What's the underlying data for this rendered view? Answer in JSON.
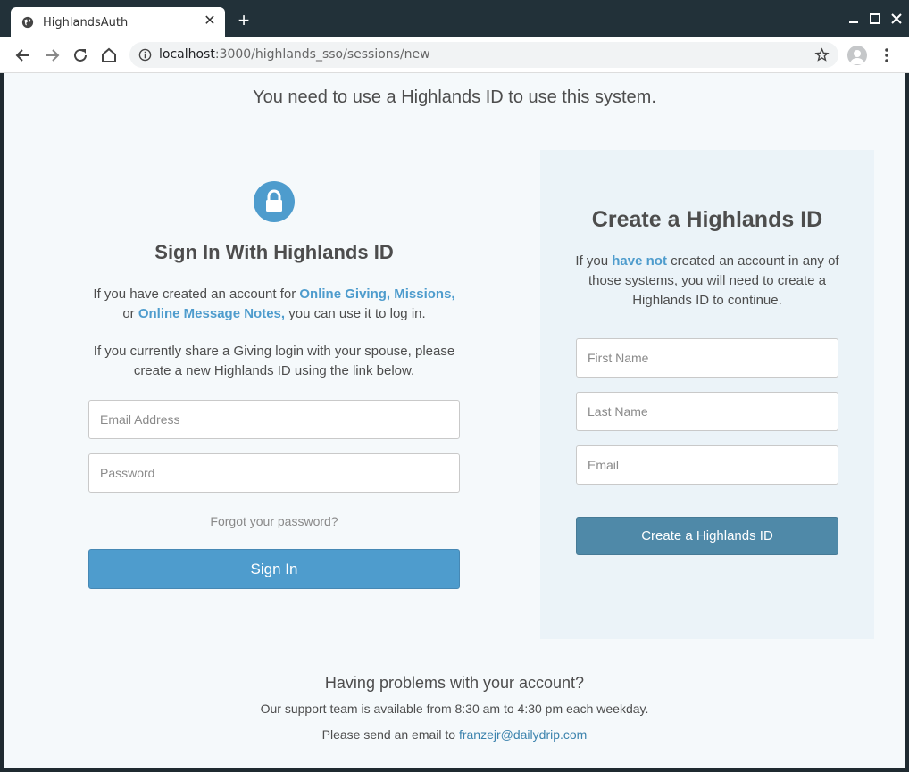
{
  "browser": {
    "tab_title": "HighlandsAuth",
    "url_host": "localhost",
    "url_rest": ":3000/highlands_sso/sessions/new"
  },
  "page": {
    "notice": "You need to use a Highlands ID to use this system."
  },
  "signin": {
    "title": "Sign In With Highlands ID",
    "p1_prefix": "If you have created an account for ",
    "p1_link1": "Online Giving, Missions,",
    "p1_mid": "or ",
    "p1_link2": "Online Message Notes,",
    "p1_suffix": " you can use it to log in.",
    "p2": "If you currently share a Giving login with your spouse, please create a new Highlands ID using the link below.",
    "email_placeholder": "Email Address",
    "password_placeholder": "Password",
    "forgot_label": "Forgot your password?",
    "button_label": "Sign In"
  },
  "create": {
    "title": "Create a Highlands ID",
    "desc_prefix": "If you ",
    "desc_emphasis": "have not",
    "desc_suffix": " created an account in any of those systems, you will need to create a Highlands ID to continue.",
    "first_name_placeholder": "First Name",
    "last_name_placeholder": "Last Name",
    "email_placeholder": "Email",
    "button_label": "Create a Highlands ID"
  },
  "help": {
    "title": "Having problems with your account?",
    "line1": "Our support team is available from 8:30 am to 4:30 pm each weekday.",
    "line2_prefix": "Please send an email to ",
    "email": "franzejr@dailydrip.com"
  },
  "colors": {
    "accent": "#4e9ccd",
    "create_button": "#4f89a8",
    "chrome": "#223139",
    "page_bg": "#f5f9fb",
    "panel_bg": "#ebf3f8"
  },
  "icons": [
    "globe-icon",
    "close-icon",
    "plus-icon",
    "minimize-icon",
    "maximize-icon",
    "window-close-icon",
    "back-arrow-icon",
    "forward-arrow-icon",
    "reload-icon",
    "home-icon",
    "info-icon",
    "star-icon",
    "profile-icon",
    "menu-dots-icon",
    "lock-icon"
  ]
}
